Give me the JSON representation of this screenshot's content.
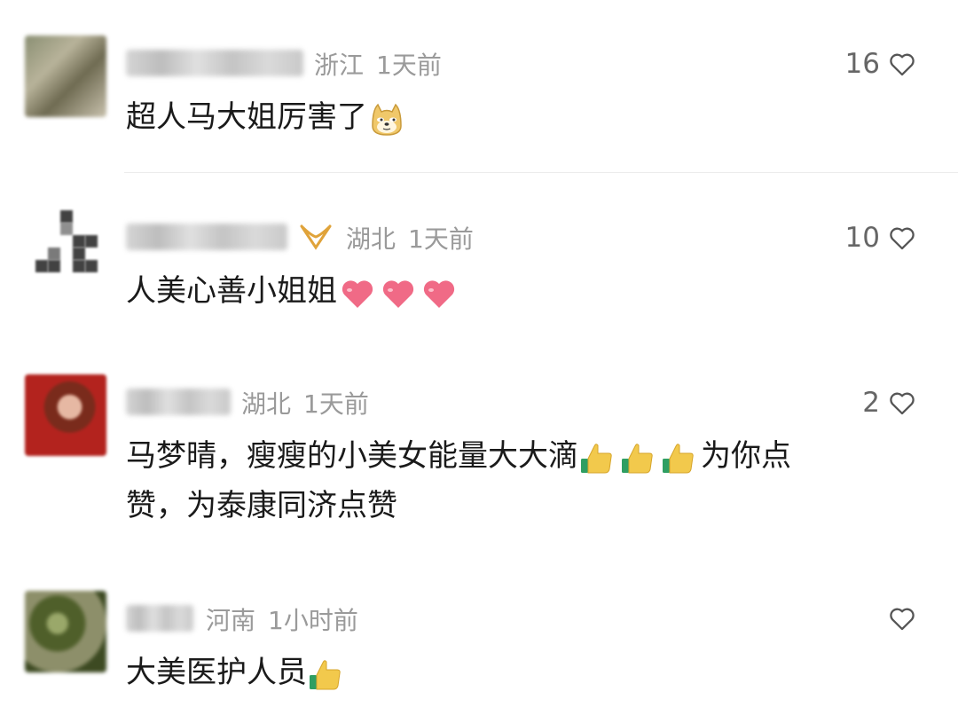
{
  "comments": [
    {
      "location": "浙江",
      "time": "1天前",
      "likes": "16",
      "text": "超人马大姐厉害了",
      "emoji": "doge-emoji"
    },
    {
      "location": "湖北",
      "time": "1天前",
      "likes": "10",
      "text": "人美心善小姐姐",
      "emoji": "heart-emoji"
    },
    {
      "location": "湖北",
      "time": "1天前",
      "likes": "2",
      "text": "马梦晴，瘦瘦的小美女能量大大滴",
      "text_after": "为你点",
      "text_line2": "赞，为泰康同济点赞",
      "emoji": "thumbs-up-emoji"
    },
    {
      "location": "河南",
      "time": "1小时前",
      "likes": "",
      "text": "大美医护人员",
      "emoji": "thumbs-up-emoji"
    }
  ],
  "colors": {
    "meta": "#9a9a9a",
    "text": "#1a1a1a",
    "heart_emoji": "#f06a86",
    "thumb": "#f2c94c",
    "badge": "#e0a33a"
  }
}
